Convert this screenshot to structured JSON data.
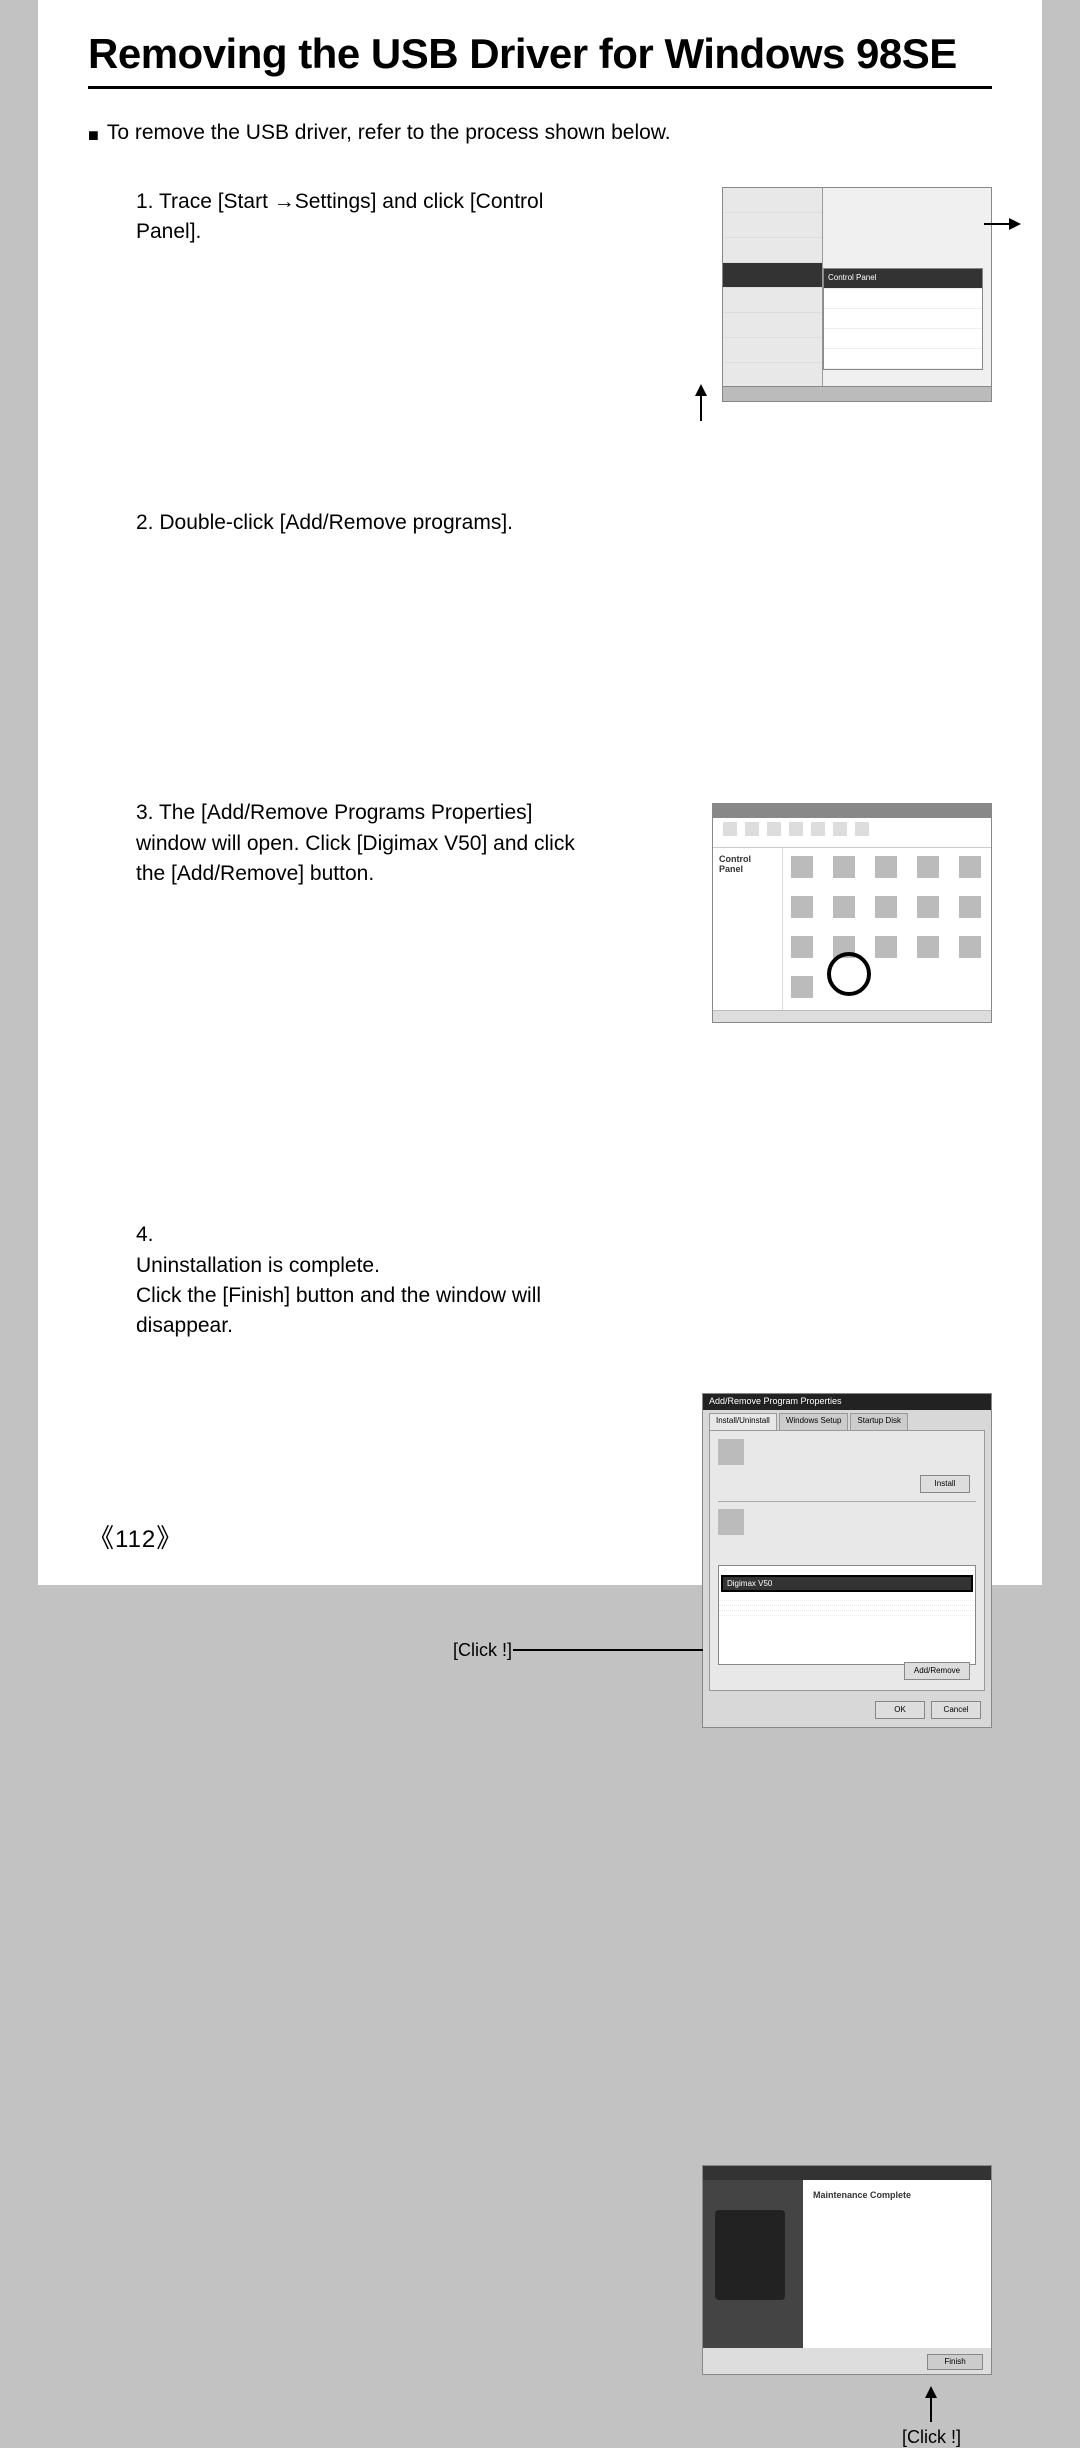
{
  "title": "Removing the USB Driver for Windows 98SE",
  "intro": "To remove the USB driver, refer to the process shown below.",
  "steps": {
    "s1_num": "1.",
    "s1a": "Trace [Start ",
    "s1_arrow": "→",
    "s1b": "Settings] and click [Control Panel].",
    "s2_num": "2.",
    "s2": "Double-click [Add/Remove programs].",
    "s3_num": "3.",
    "s3": "The [Add/Remove Programs Properties] window will open. Click [Digimax V50] and click the [Add/Remove] button.",
    "s4_num": "4.",
    "s4": "Uninstallation is complete.\nClick the [Finish] button and the window will disappear."
  },
  "callouts": {
    "click1": "[Click !]",
    "click2": "[Click !]"
  },
  "fig1": {
    "submenu_cp": "Control Panel"
  },
  "fig2": {
    "side_title": "Control Panel"
  },
  "fig3": {
    "title": "Add/Remove Program Properties",
    "tab1": "Install/Uninstall",
    "tab2": "Windows Setup",
    "tab3": "Startup Disk",
    "install_btn": "Install",
    "addremove_btn": "Add/Remove",
    "ok_btn": "OK",
    "cancel_btn": "Cancel",
    "list_selected": "Digimax V50"
  },
  "fig4": {
    "heading": "Maintenance Complete",
    "finish_btn": "Finish"
  },
  "page_number": "112"
}
